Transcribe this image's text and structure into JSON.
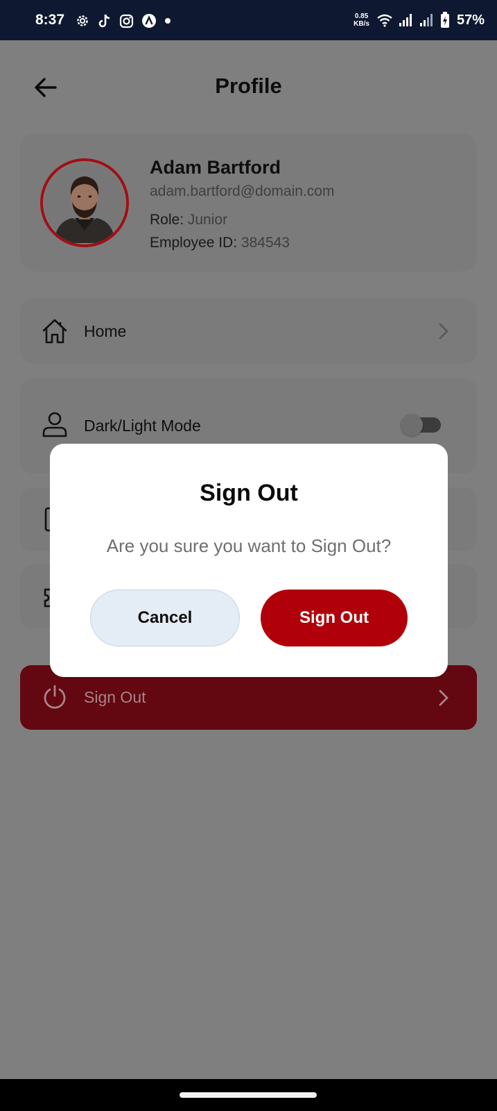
{
  "status_bar": {
    "time": "8:37",
    "net_speed_value": "0.85",
    "net_speed_unit": "KB/s",
    "battery": "57%",
    "left_icons": [
      "gear-icon",
      "tiktok-icon",
      "instagram-icon",
      "app-a-icon",
      "dot-icon"
    ],
    "right_icons": [
      "wifi-icon",
      "signal-icon",
      "signal-icon",
      "battery-charging-icon"
    ]
  },
  "header": {
    "title": "Profile",
    "back_icon": "arrow-left-icon"
  },
  "profile": {
    "name": "Adam Bartford",
    "email": "adam.bartford@domain.com",
    "role_label": "Role:",
    "role_value": "Junior",
    "employee_id_label": "Employee ID:",
    "employee_id_value": "384543",
    "avatar_ring_color": "#a10f14"
  },
  "menu": {
    "home": {
      "label": "Home",
      "icon": "home-icon"
    },
    "mode": {
      "label": "Dark/Light Mode",
      "icon": "user-icon",
      "toggle_on": false
    },
    "hidden_row_1_icon": "document-icon",
    "hidden_row_2_icon": "puzzle-icon",
    "sign_out": {
      "label": "Sign Out",
      "icon": "power-icon"
    }
  },
  "dialog": {
    "title": "Sign Out",
    "message": "Are you sure you want to Sign Out?",
    "cancel_label": "Cancel",
    "confirm_label": "Sign Out",
    "confirm_color": "#b00009"
  },
  "colors": {
    "status_bar_bg": "#0e1830",
    "accent": "#b00009",
    "scrim": "#7f7f80"
  }
}
